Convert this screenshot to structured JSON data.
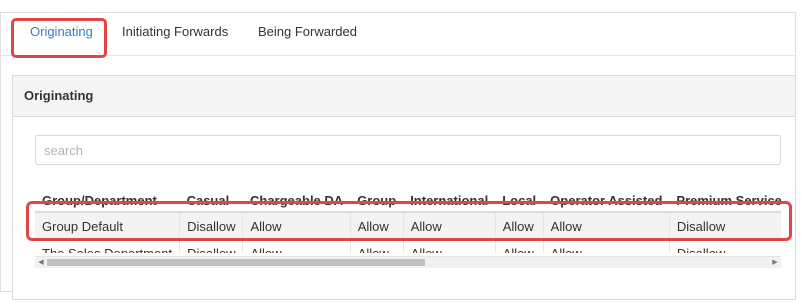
{
  "tabs": [
    {
      "label": "Originating",
      "active": true
    },
    {
      "label": "Initiating Forwards",
      "active": false
    },
    {
      "label": "Being Forwarded",
      "active": false
    }
  ],
  "panel": {
    "title": "Originating",
    "search_placeholder": "search"
  },
  "table": {
    "columns": [
      "Group/Department",
      "Casual",
      "Chargeable DA",
      "Group",
      "International",
      "Local",
      "Operator Assisted",
      "Premium Service"
    ],
    "rows": [
      [
        "Group Default",
        "Disallow",
        "Allow",
        "Allow",
        "Allow",
        "Allow",
        "Allow",
        "Disallow"
      ],
      [
        "The Sales Department",
        "Disallow",
        "Allow",
        "Allow",
        "Allow",
        "Allow",
        "Allow",
        "Disallow"
      ]
    ]
  },
  "scrollbar": {
    "left_icon": "triangle-left-icon",
    "right_icon": "triangle-right-icon"
  },
  "colors": {
    "accent": "#3a7ac8",
    "highlight": "#e04646",
    "panel_header_bg": "#f5f5f5"
  }
}
